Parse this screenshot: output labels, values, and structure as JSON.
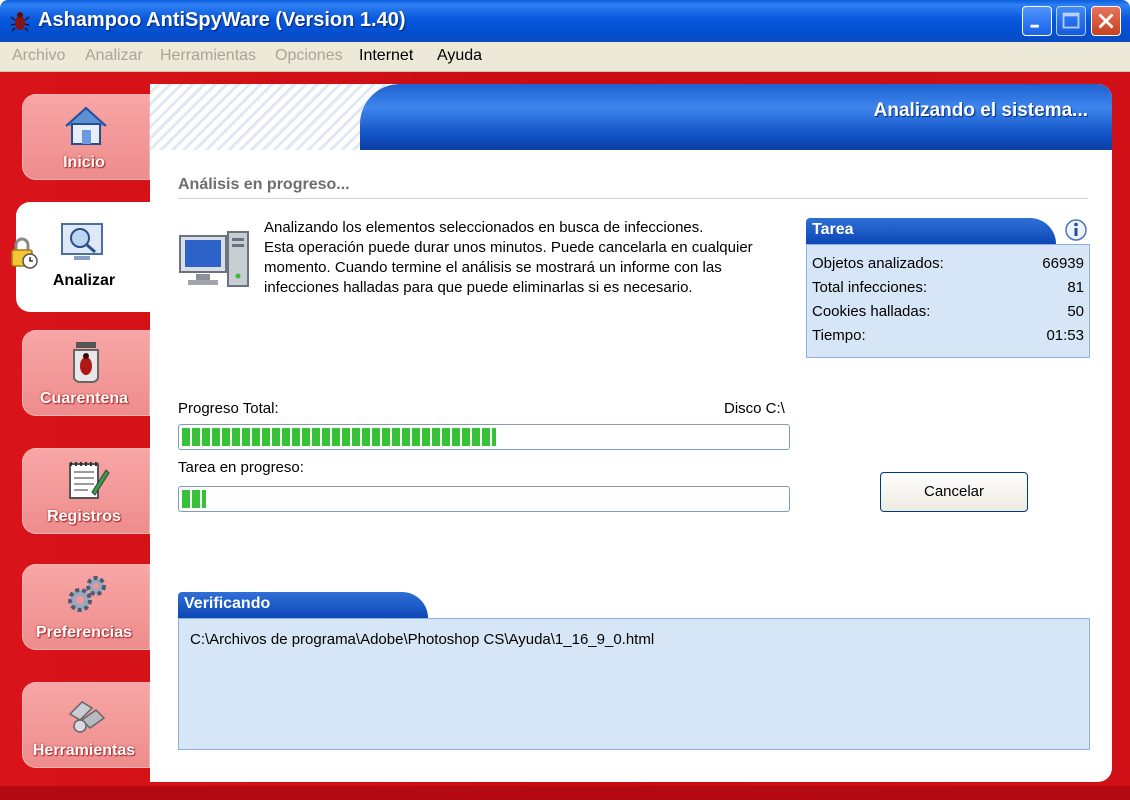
{
  "window": {
    "title": "Ashampoo AntiSpyWare (Version 1.40)",
    "controls": [
      "minimize",
      "maximize",
      "close"
    ]
  },
  "menu": {
    "items": [
      {
        "label": "Archivo",
        "enabled": false
      },
      {
        "label": "Analizar",
        "enabled": false
      },
      {
        "label": "Herramientas",
        "enabled": false
      },
      {
        "label": "Opciones",
        "enabled": false
      },
      {
        "label": "Internet",
        "enabled": true
      },
      {
        "label": "Ayuda",
        "enabled": true
      }
    ]
  },
  "sidebar": {
    "items": [
      {
        "label": "Inicio",
        "icon": "house-icon",
        "active": false
      },
      {
        "label": "Analizar",
        "icon": "magnifier-monitor-icon",
        "active": true
      },
      {
        "label": "Cuarentena",
        "icon": "bug-jar-icon",
        "active": false
      },
      {
        "label": "Registros",
        "icon": "notepad-pencil-icon",
        "active": false
      },
      {
        "label": "Preferencias",
        "icon": "gears-icon",
        "active": false
      },
      {
        "label": "Herramientas",
        "icon": "tools-icon",
        "active": false
      }
    ]
  },
  "header": {
    "title": "Analizando el sistema..."
  },
  "section": {
    "title": "Análisis en progreso...",
    "description": [
      "Analizando los elementos seleccionados en busca de infecciones.",
      "Esta operación puede durar unos minutos. Puede cancelarla en cualquier",
      "momento. Cuando termine el análisis se mostrará un informe con las",
      "infecciones halladas para que puede eliminarlas si es necesario."
    ]
  },
  "task": {
    "title": "Tarea",
    "rows": [
      {
        "label": "Objetos analizados:",
        "value": "66939"
      },
      {
        "label": "Total infecciones:",
        "value": "81"
      },
      {
        "label": "Cookies halladas:",
        "value": "50"
      },
      {
        "label": "Tiempo:",
        "value": "01:53"
      }
    ]
  },
  "progress": {
    "total_label": "Progreso Total:",
    "total_target": "Disco C:\\",
    "total_fraction": 0.52,
    "task_label": "Tarea en progreso:",
    "task_fraction": 0.04
  },
  "cancel_button": "Cancelar",
  "verify": {
    "title": "Verificando",
    "path": "C:\\Archivos de programa\\Adobe\\Photoshop CS\\Ayuda\\1_16_9_0.html"
  },
  "colors": {
    "frame_red": "#d9141a",
    "accent_blue": "#0c48b6",
    "progress_green": "#37c337",
    "panel_blue": "#d7e6f6"
  }
}
